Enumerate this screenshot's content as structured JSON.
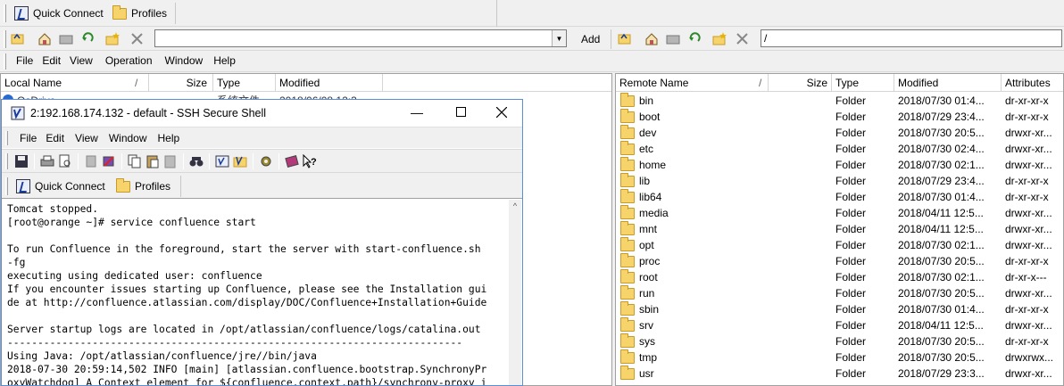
{
  "quick_connect_label": "Quick Connect",
  "profiles_label": "Profiles",
  "add_label": "Add",
  "local_path": "",
  "remote_path": "/",
  "menu": [
    "File",
    "Edit",
    "View",
    "Operation",
    "Window",
    "Help"
  ],
  "local_columns": [
    "Local Name",
    "Size",
    "Type",
    "Modified"
  ],
  "local_partial_row": {
    "name": "OsDrive",
    "type": "系统文件...",
    "modified": "2018/06/08 12:3..."
  },
  "remote_columns": [
    "Remote Name",
    "Size",
    "Type",
    "Modified",
    "Attributes"
  ],
  "remote_rows": [
    {
      "name": "bin",
      "type": "Folder",
      "modified": "2018/07/30 01:4...",
      "attr": "dr-xr-xr-x"
    },
    {
      "name": "boot",
      "type": "Folder",
      "modified": "2018/07/29 23:4...",
      "attr": "dr-xr-xr-x"
    },
    {
      "name": "dev",
      "type": "Folder",
      "modified": "2018/07/30 20:5...",
      "attr": "drwxr-xr..."
    },
    {
      "name": "etc",
      "type": "Folder",
      "modified": "2018/07/30 02:4...",
      "attr": "drwxr-xr..."
    },
    {
      "name": "home",
      "type": "Folder",
      "modified": "2018/07/30 02:1...",
      "attr": "drwxr-xr..."
    },
    {
      "name": "lib",
      "type": "Folder",
      "modified": "2018/07/29 23:4...",
      "attr": "dr-xr-xr-x"
    },
    {
      "name": "lib64",
      "type": "Folder",
      "modified": "2018/07/30 01:4...",
      "attr": "dr-xr-xr-x"
    },
    {
      "name": "media",
      "type": "Folder",
      "modified": "2018/04/11 12:5...",
      "attr": "drwxr-xr..."
    },
    {
      "name": "mnt",
      "type": "Folder",
      "modified": "2018/04/11 12:5...",
      "attr": "drwxr-xr..."
    },
    {
      "name": "opt",
      "type": "Folder",
      "modified": "2018/07/30 02:1...",
      "attr": "drwxr-xr..."
    },
    {
      "name": "proc",
      "type": "Folder",
      "modified": "2018/07/30 20:5...",
      "attr": "dr-xr-xr-x"
    },
    {
      "name": "root",
      "type": "Folder",
      "modified": "2018/07/30 02:1...",
      "attr": "dr-xr-x---"
    },
    {
      "name": "run",
      "type": "Folder",
      "modified": "2018/07/30 20:5...",
      "attr": "drwxr-xr..."
    },
    {
      "name": "sbin",
      "type": "Folder",
      "modified": "2018/07/30 01:4...",
      "attr": "dr-xr-xr-x"
    },
    {
      "name": "srv",
      "type": "Folder",
      "modified": "2018/04/11 12:5...",
      "attr": "drwxr-xr..."
    },
    {
      "name": "sys",
      "type": "Folder",
      "modified": "2018/07/30 20:5...",
      "attr": "dr-xr-xr-x"
    },
    {
      "name": "tmp",
      "type": "Folder",
      "modified": "2018/07/30 20:5...",
      "attr": "drwxrwx..."
    },
    {
      "name": "usr",
      "type": "Folder",
      "modified": "2018/07/29 23:3...",
      "attr": "drwxr-xr..."
    }
  ],
  "ssh_window": {
    "title": "2:192.168.174.132 - default - SSH Secure Shell",
    "menu": [
      "File",
      "Edit",
      "View",
      "Window",
      "Help"
    ],
    "quick_connect_label": "Quick Connect",
    "profiles_label": "Profiles",
    "terminal_lines": [
      "Tomcat stopped.",
      "[root@orange ~]# service confluence start",
      "",
      "To run Confluence in the foreground, start the server with start-confluence.sh",
      "-fg",
      "executing using dedicated user: confluence",
      "If you encounter issues starting up Confluence, please see the Installation gui",
      "de at http://confluence.atlassian.com/display/DOC/Confluence+Installation+Guide",
      "",
      "Server startup logs are located in /opt/atlassian/confluence/logs/catalina.out",
      "---------------------------------------------------------------------------",
      "Using Java: /opt/atlassian/confluence/jre//bin/java",
      "2018-07-30 20:59:14,502 INFO [main] [atlassian.confluence.bootstrap.SynchronyPr",
      "oxyWatchdog] A Context element for ${confluence.context.path}/synchrony-proxy i"
    ]
  }
}
